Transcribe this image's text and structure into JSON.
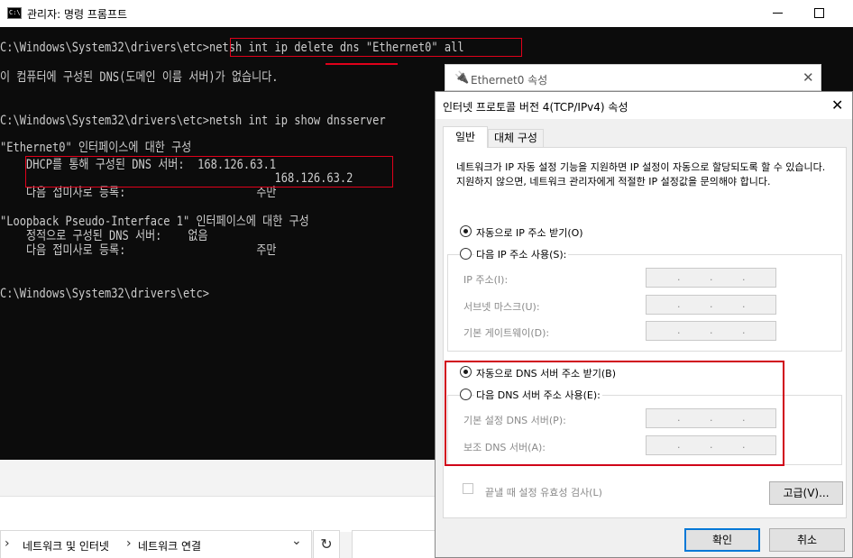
{
  "cmd": {
    "title": "관리자: 명령 프롬프트",
    "icon_label": "C:\\",
    "lines": [
      "C:\\Windows\\System32\\drivers\\etc>netsh int ip delete dns \"Ethernet0\" all",
      "이 컴퓨터에 구성된 DNS(도메인 이름 서버)가 없습니다.",
      "",
      "C:\\Windows\\System32\\drivers\\etc>netsh int ip show dnsserver",
      "",
      "\"Ethernet0\" 인터페이스에 대한 구성",
      "    DHCP를 통해 구성된 DNS 서버:  168.126.63.1",
      "                                          168.126.63.2",
      "    다음 접미사로 등록:                    주만",
      "",
      "\"Loopback Pseudo-Interface 1\" 인터페이스에 대한 구성",
      "    정적으로 구성된 DNS 서버:    없음",
      "    다음 접미사로 등록:                    주만",
      "",
      "C:\\Windows\\System32\\drivers\\etc>"
    ],
    "colors": {
      "background": "#0c0c0c",
      "text": "#cccccc",
      "highlight": "#e0001a"
    }
  },
  "explorer": {
    "breadcrumb": [
      "네트워크 및 인터넷",
      "네트워크 연결"
    ],
    "chevron": "›",
    "dropdown": "⌄",
    "refresh": "↻"
  },
  "ethernet_window": {
    "title": "Ethernet0 속성",
    "close": "✕",
    "icon": "plug-icon"
  },
  "ipv4_dialog": {
    "title": "인터넷 프로토콜 버전 4(TCP/IPv4) 속성",
    "close": "✕",
    "tabs": [
      "일반",
      "대체 구성"
    ],
    "description": "네트워크가 IP 자동 설정 기능을 지원하면 IP 설정이 자동으로 할당되도록 할 수 있습니다. 지원하지 않으면, 네트워크 관리자에게 적절한 IP 설정값을 문의해야 합니다.",
    "ip_auto": "자동으로 IP 주소 받기(O)",
    "ip_manual": "다음 IP 주소 사용(S):",
    "ip_fields": [
      {
        "label": "IP 주소(I):"
      },
      {
        "label": "서브넷 마스크(U):"
      },
      {
        "label": "기본 게이트웨이(D):"
      }
    ],
    "dns_auto": "자동으로 DNS 서버 주소 받기(B)",
    "dns_manual": "다음 DNS 서버 주소 사용(E):",
    "dns_fields": [
      {
        "label": "기본 설정 DNS 서버(P):"
      },
      {
        "label": "보조 DNS 서버(A):"
      }
    ],
    "field_dots": ".",
    "validate_label": "끝낼 때 설정 유효성 검사(L)",
    "advanced_button": "고급(V)...",
    "ok_button": "확인",
    "cancel_button": "취소",
    "selected": {
      "ip": "auto",
      "dns": "auto"
    }
  }
}
